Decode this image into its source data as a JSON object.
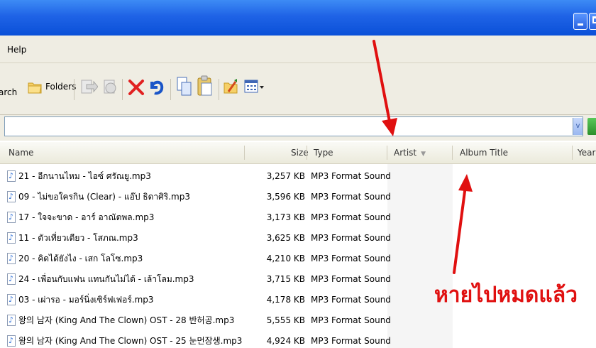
{
  "menu": {
    "help_label": "Help"
  },
  "toolbar": {
    "search_label": "arch",
    "folders_label": "Folders"
  },
  "columns": {
    "name": "Name",
    "size": "Size",
    "type": "Type",
    "artist": "Artist",
    "album": "Album Title",
    "year": "Year"
  },
  "files": [
    {
      "name": "21 - อีกนานไหม - ไอซ์ ศรัณยู.mp3",
      "size": "3,257 KB",
      "type": "MP3 Format Sound"
    },
    {
      "name": "09 - ไม่ขอใครกิน (Clear) - แอ๊ป ธิดาศิริ.mp3",
      "size": "3,596 KB",
      "type": "MP3 Format Sound"
    },
    {
      "name": "17 - ใจจะขาด - อาร์ อาณัตพล.mp3",
      "size": "3,173 KB",
      "type": "MP3 Format Sound"
    },
    {
      "name": "11 - ตัวเที่ยวเดียว - โสภณ.mp3",
      "size": "3,625 KB",
      "type": "MP3 Format Sound"
    },
    {
      "name": "20 - คิดได้ยังไง - เสก โลโซ.mp3",
      "size": "4,210 KB",
      "type": "MP3 Format Sound"
    },
    {
      "name": "24 - เพื่อนกับแฟน แทนกันไม่ได้ - เล้าโลม.mp3",
      "size": "3,715 KB",
      "type": "MP3 Format Sound"
    },
    {
      "name": "03 - เผ่ารอ - มอร์นิ่งเซิร์ฟเฟอร์.mp3",
      "size": "4,178 KB",
      "type": "MP3 Format Sound"
    },
    {
      "name": "왕의 남자 (King And The Clown) OST - 28 반허공.mp3",
      "size": "5,555 KB",
      "type": "MP3 Format Sound"
    },
    {
      "name": "왕의 남자 (King And The Clown) OST - 25 눈먼장생.mp3",
      "size": "4,924 KB",
      "type": "MP3 Format Sound"
    }
  ],
  "annotation": {
    "text": "หายไปหมดแล้ว",
    "color": "#e01010"
  },
  "colors": {
    "titlebar": "#1f63e6",
    "chrome": "#efede3",
    "annotation": "#e01010"
  }
}
